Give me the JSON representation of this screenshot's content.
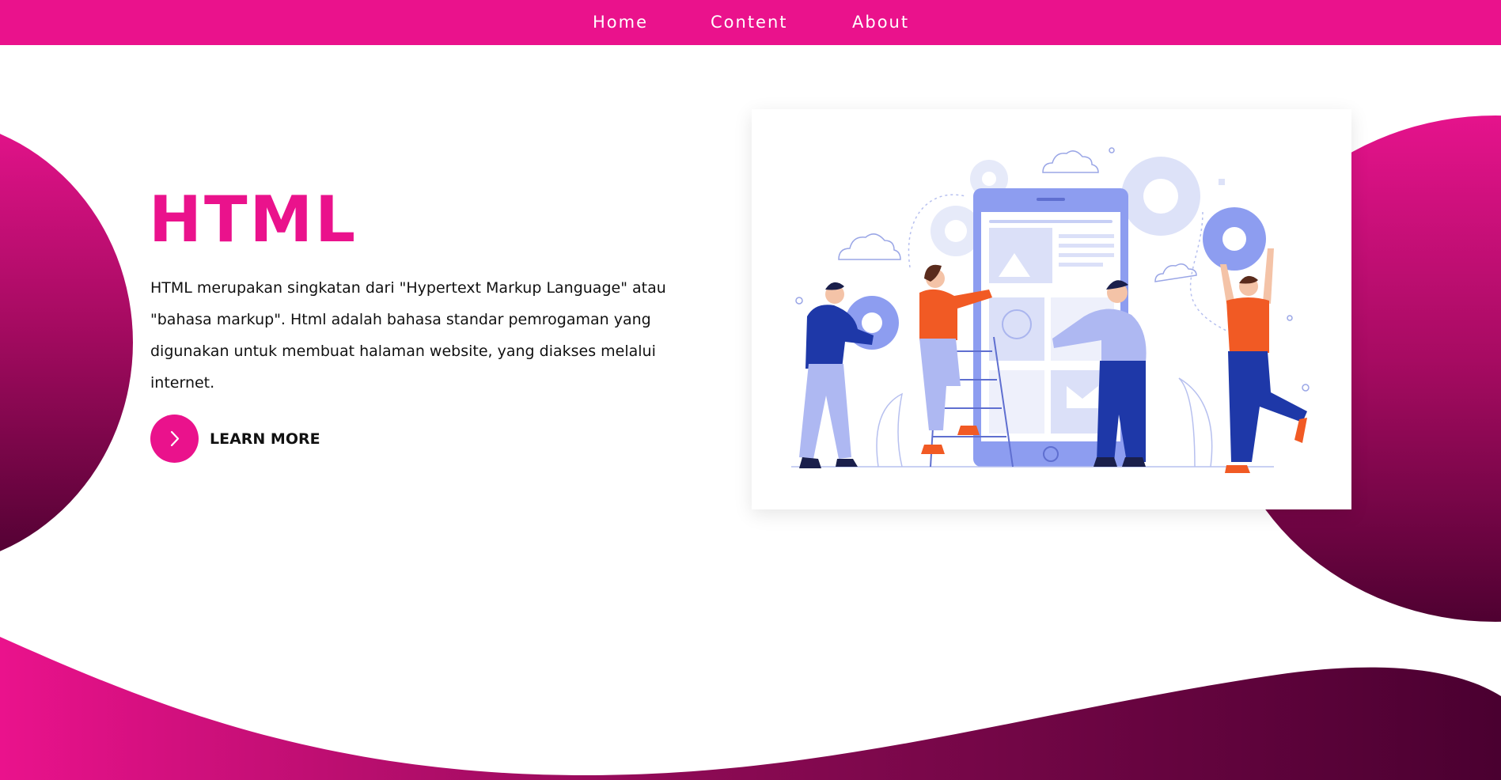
{
  "nav": {
    "items": [
      "Home",
      "Content",
      "About"
    ]
  },
  "hero": {
    "title": "HTML",
    "description": "HTML merupakan singkatan dari \"Hypertext Markup Language\" atau \"bahasa markup\". Html adalah bahasa standar pemrogaman yang digunakan untuk membuat halaman website, yang diakses melalui internet.",
    "cta_label": "LEARN MORE",
    "cta_icon": "chevron-right-icon"
  },
  "illustration": {
    "subject": "people-building-mobile-app-illustration"
  },
  "colors": {
    "accent": "#ea128c",
    "dark": "#4f0131",
    "illustration_blue": "#8d9df0",
    "illustration_orange": "#f15a24"
  }
}
